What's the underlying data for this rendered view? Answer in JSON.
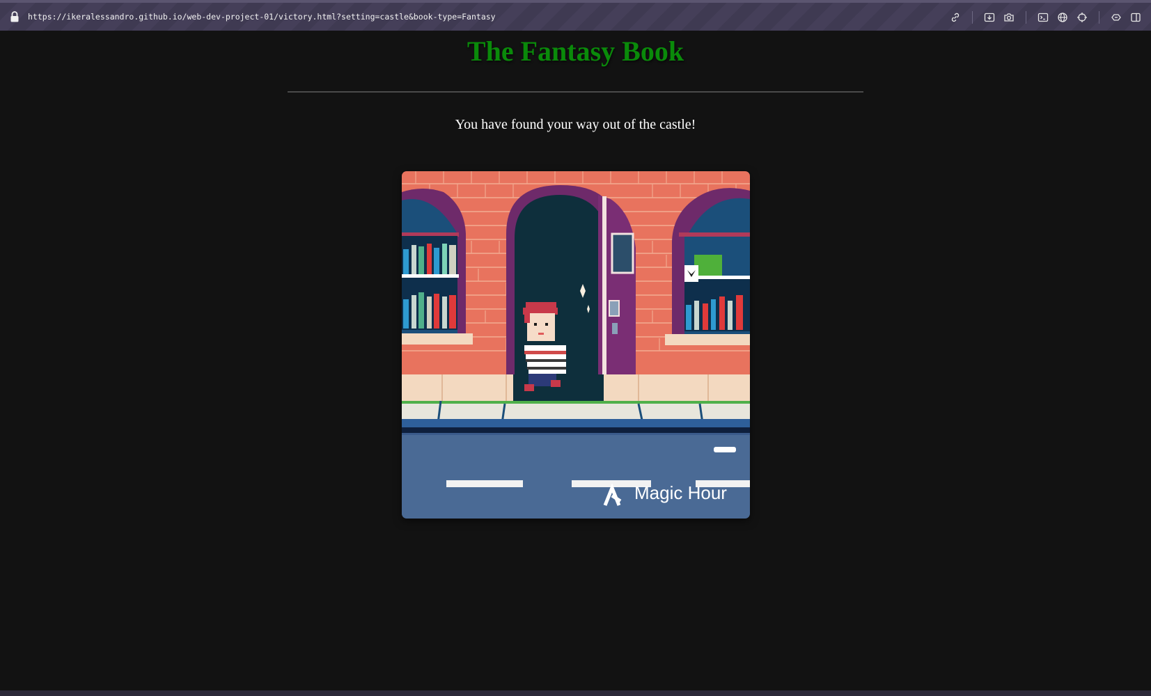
{
  "browser": {
    "url": "https://ikeralessandro.github.io/web-dev-project-01/victory.html?setting=castle&book-type=Fantasy",
    "toolbar_icons": [
      "link-icon",
      "download-icon",
      "camera-icon",
      "terminal-icon",
      "globe-icon",
      "crosshair-icon",
      "extensions-icon",
      "sidebar-icon"
    ]
  },
  "page": {
    "title": "The Fantasy Book",
    "message": "You have found your way out of the castle!",
    "image": {
      "watermark": "Magic Hour"
    }
  },
  "colors": {
    "background": "#121212",
    "title": "#0a8a0a",
    "text": "#ffffff",
    "brick": "#e8735e",
    "door": "#6e2a6a",
    "road": "#4a6a95"
  }
}
